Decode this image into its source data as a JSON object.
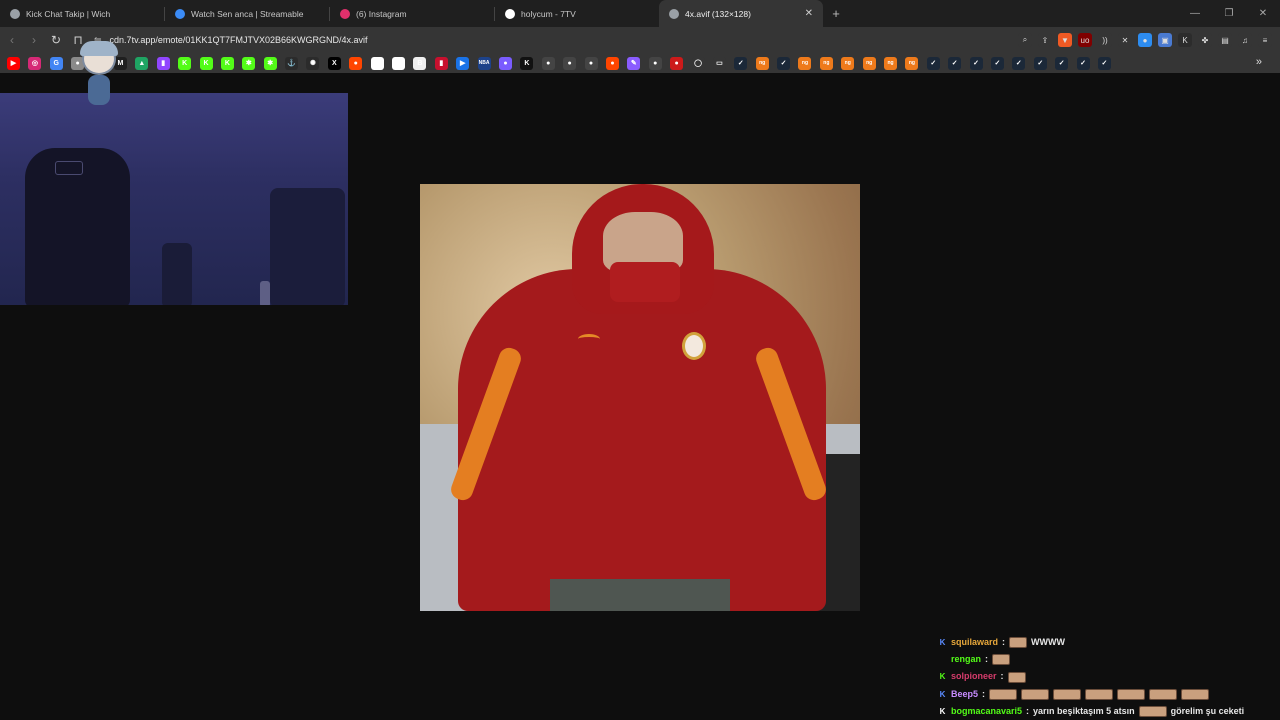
{
  "tabs": [
    {
      "title": "Kick Chat Takip | Wich",
      "favicon_color": "#9aa0a6",
      "active": false
    },
    {
      "title": "Watch Sen anca | Streamable",
      "favicon_color": "#3b8bf5",
      "active": false
    },
    {
      "title": "(6) Instagram",
      "favicon_color": "#e1306c",
      "active": false
    },
    {
      "title": "holycum - 7TV",
      "favicon_color": "#ffffff",
      "active": false
    },
    {
      "title": "4x.avif (132×128)",
      "favicon_color": "#9aa0a6",
      "active": true
    }
  ],
  "new_tab_label": "+",
  "window_controls": {
    "minimize": "—",
    "restore": "❐",
    "close": "✕"
  },
  "toolbar": {
    "back": "‹",
    "forward": "›",
    "reload": "↻",
    "bookmark": "⊓",
    "site_info": "⇋",
    "url": "cdn.7tv.app/emote/01KK1QT7FMJTVX02B66KWGRGND/4x.avif"
  },
  "toolbar_icons": [
    {
      "name": "zoom-icon",
      "glyph": "⌕",
      "color": "#353535"
    },
    {
      "name": "share-icon",
      "glyph": "⇪",
      "color": "#353535"
    },
    {
      "name": "brave-shield-icon",
      "glyph": "▼",
      "color": "#f05a24"
    },
    {
      "name": "ublock-icon",
      "glyph": "uo",
      "color": "#800000"
    },
    {
      "name": "audio-icon",
      "glyph": "))",
      "color": "#353535"
    },
    {
      "name": "extension-gray-icon",
      "glyph": "✕",
      "color": "#353535"
    },
    {
      "name": "extension-blue-icon",
      "glyph": "●",
      "color": "#2d8cf0"
    },
    {
      "name": "translate-icon",
      "glyph": "▣",
      "color": "#4a7ad1"
    },
    {
      "name": "kick-extension-icon",
      "glyph": "K",
      "color": "#2c2c2c"
    },
    {
      "name": "extensions-icon",
      "glyph": "✤",
      "color": "#353535"
    },
    {
      "name": "sidebar-icon",
      "glyph": "▤",
      "color": "#353535"
    },
    {
      "name": "playlist-icon",
      "glyph": "♫",
      "color": "#353535"
    },
    {
      "name": "menu-icon",
      "glyph": "≡",
      "color": "#353535"
    }
  ],
  "bookmarks": [
    {
      "name": "youtube",
      "glyph": "▶",
      "color": "#ff0000"
    },
    {
      "name": "instagram",
      "glyph": "◎",
      "color": "#d62976"
    },
    {
      "name": "translate",
      "glyph": "G",
      "color": "#4285f4"
    },
    {
      "name": "site-a",
      "glyph": "●",
      "color": "#8a8a8a"
    },
    {
      "name": "site-b",
      "glyph": "●",
      "color": "#6a6a6a"
    },
    {
      "name": "gmail",
      "glyph": "M",
      "color": "#1f1f1f"
    },
    {
      "name": "drive",
      "glyph": "▲",
      "color": "#1fa463"
    },
    {
      "name": "twitch",
      "glyph": "▮",
      "color": "#9146ff"
    },
    {
      "name": "kick-1",
      "glyph": "K",
      "color": "#53fc18"
    },
    {
      "name": "kick-2",
      "glyph": "K",
      "color": "#53fc18"
    },
    {
      "name": "kick-3",
      "glyph": "K",
      "color": "#53fc18"
    },
    {
      "name": "sync-1",
      "glyph": "✱",
      "color": "#53fc18"
    },
    {
      "name": "sync-2",
      "glyph": "✱",
      "color": "#53fc18"
    },
    {
      "name": "anchor",
      "glyph": "⚓",
      "color": "#2b2b2b"
    },
    {
      "name": "chatgpt",
      "glyph": "✺",
      "color": "#2b2b2b"
    },
    {
      "name": "x",
      "glyph": "X",
      "color": "#000000"
    },
    {
      "name": "reddit",
      "glyph": "●",
      "color": "#ff4500"
    },
    {
      "name": "p-site",
      "glyph": "P",
      "color": "#ffffff"
    },
    {
      "name": "amazon",
      "glyph": "a",
      "color": "#ffffff"
    },
    {
      "name": "r-site",
      "glyph": "B",
      "color": "#f0f0f0"
    },
    {
      "name": "redsite",
      "glyph": "▮",
      "color": "#c8102e"
    },
    {
      "name": "bluecircle",
      "glyph": "▶",
      "color": "#1a73e8"
    },
    {
      "name": "nba",
      "glyph": "NBA",
      "color": "#1d428a"
    },
    {
      "name": "globe",
      "glyph": "●",
      "color": "#7a5cff"
    },
    {
      "name": "kx",
      "glyph": "K",
      "color": "#111111"
    },
    {
      "name": "github-1",
      "glyph": "●",
      "color": "#444444"
    },
    {
      "name": "github-2",
      "glyph": "●",
      "color": "#444444"
    },
    {
      "name": "github-3",
      "glyph": "●",
      "color": "#444444"
    },
    {
      "name": "reddit-2",
      "glyph": "●",
      "color": "#ff4500"
    },
    {
      "name": "feather",
      "glyph": "✎",
      "color": "#8a5cff"
    },
    {
      "name": "github-4",
      "glyph": "●",
      "color": "#444444"
    },
    {
      "name": "red-dot",
      "glyph": "●",
      "color": "#cc1a1a"
    },
    {
      "name": "circle-outline",
      "glyph": "◯",
      "color": "#353535"
    },
    {
      "name": "folder",
      "glyph": "▭",
      "color": "#353535"
    },
    {
      "name": "steam-1",
      "glyph": "✓",
      "color": "#1b2838"
    },
    {
      "name": "ng-1",
      "glyph": "ng",
      "color": "#ee7a1b"
    },
    {
      "name": "steam-2",
      "glyph": "✓",
      "color": "#1b2838"
    },
    {
      "name": "ng-2",
      "glyph": "ng",
      "color": "#ee7a1b"
    },
    {
      "name": "ng-3",
      "glyph": "ng",
      "color": "#ee7a1b"
    },
    {
      "name": "ng-4",
      "glyph": "ng",
      "color": "#ee7a1b"
    },
    {
      "name": "ng-5",
      "glyph": "ng",
      "color": "#ee7a1b"
    },
    {
      "name": "ng-6",
      "glyph": "ng",
      "color": "#ee7a1b"
    },
    {
      "name": "ng-7",
      "glyph": "ng",
      "color": "#ee7a1b"
    },
    {
      "name": "steam-3",
      "glyph": "✓",
      "color": "#1b2838"
    },
    {
      "name": "steam-4",
      "glyph": "✓",
      "color": "#1b2838"
    },
    {
      "name": "steam-5",
      "glyph": "✓",
      "color": "#1b2838"
    },
    {
      "name": "steam-6",
      "glyph": "✓",
      "color": "#1b2838"
    },
    {
      "name": "steam-7",
      "glyph": "✓",
      "color": "#1b2838"
    },
    {
      "name": "steam-8",
      "glyph": "✓",
      "color": "#1b2838"
    },
    {
      "name": "steam-9",
      "glyph": "✓",
      "color": "#1b2838"
    },
    {
      "name": "steam-10",
      "glyph": "✓",
      "color": "#1b2838"
    },
    {
      "name": "steam-11",
      "glyph": "✓",
      "color": "#1b2838"
    }
  ],
  "bookmarks_more": "»",
  "chat": [
    {
      "badge": "K",
      "badge_color": "#5b8cff",
      "user": "squilaward",
      "user_color": "#e8a83b",
      "text": "WWWW",
      "emotes": 1,
      "emote_after": 0
    },
    {
      "badge": "",
      "badge_color": "#53fc18",
      "user": "rengan",
      "user_color": "#53fc18",
      "text": "",
      "emotes": 1,
      "emote_after": 0
    },
    {
      "badge": "K",
      "badge_color": "#53fc18",
      "user": "solpioneer",
      "user_color": "#d63c6c",
      "text": "",
      "emotes": 1,
      "emote_after": 0
    },
    {
      "badge": "K",
      "badge_color": "#5b8cff",
      "user": "Beep5",
      "user_color": "#c88cff",
      "text": "",
      "emotes": 7,
      "emote_after": 0
    },
    {
      "badge": "K",
      "badge_color": "#ffffff",
      "user": "bogmacanavari5",
      "user_color": "#53fc18",
      "text": "yarın beşiktaşım 5 atsın",
      "emotes": 1,
      "emote_after": 1,
      "text2": "görelim şu ceketi"
    }
  ]
}
